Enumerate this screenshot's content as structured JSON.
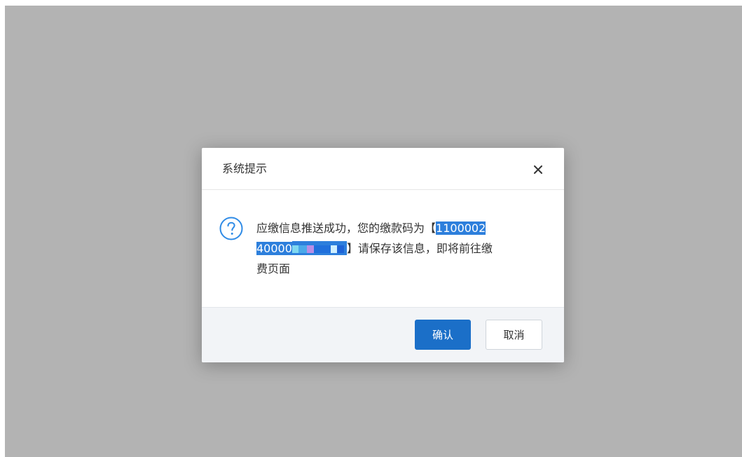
{
  "dialog": {
    "title": "系统提示",
    "close_icon": "close-icon",
    "question_icon": "question-circle-icon",
    "message": {
      "prefix": "应缴信息推送成功，您的缴款码为",
      "open_bracket": "【",
      "code_line1": "1100002",
      "code_line2_visible": "40000",
      "close_bracket": "】",
      "after_code": "请保存该信息，即将前往缴",
      "last_line": "费页面"
    },
    "confirm_label": "确认",
    "cancel_label": "取消"
  },
  "colors": {
    "overlay": "#b3b3b3",
    "highlight": "#2d7fdc",
    "primary_button": "#1b6fc8",
    "footer_bg": "#f2f4f7",
    "icon_accent": "#2f8be6"
  }
}
